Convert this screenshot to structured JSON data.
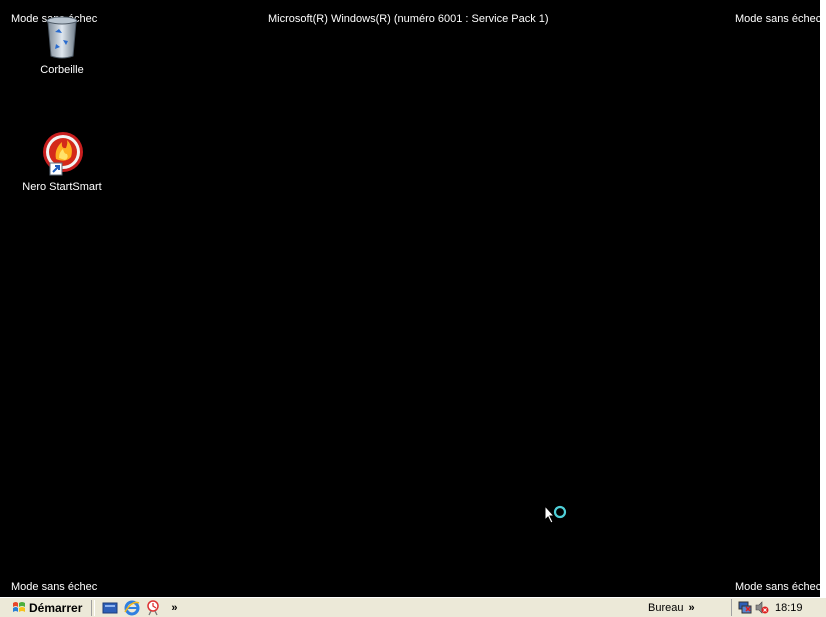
{
  "overlay": {
    "top_left": "Mode sans échec",
    "top_center": "Microsoft(R) Windows(R) (numéro 6001 : Service Pack 1)",
    "top_right": "Mode sans échec",
    "bottom_left": "Mode sans échec",
    "bottom_right": "Mode sans échec"
  },
  "desktop": {
    "icons": [
      {
        "label": "Corbeille",
        "icon": "recycle-bin-icon"
      },
      {
        "label": "Nero StartSmart",
        "icon": "nero-icon"
      }
    ]
  },
  "taskbar": {
    "start_label": "Démarrer",
    "quick_launch": [
      "show-desktop-icon",
      "internet-explorer-icon",
      "media-icon"
    ],
    "more": "»",
    "toolbar_label": "Bureau",
    "toolbar_more": "»",
    "clock": "18:19"
  },
  "colors": {
    "background": "#000000",
    "taskbar": "#ece9d8",
    "text": "#ffffff"
  }
}
